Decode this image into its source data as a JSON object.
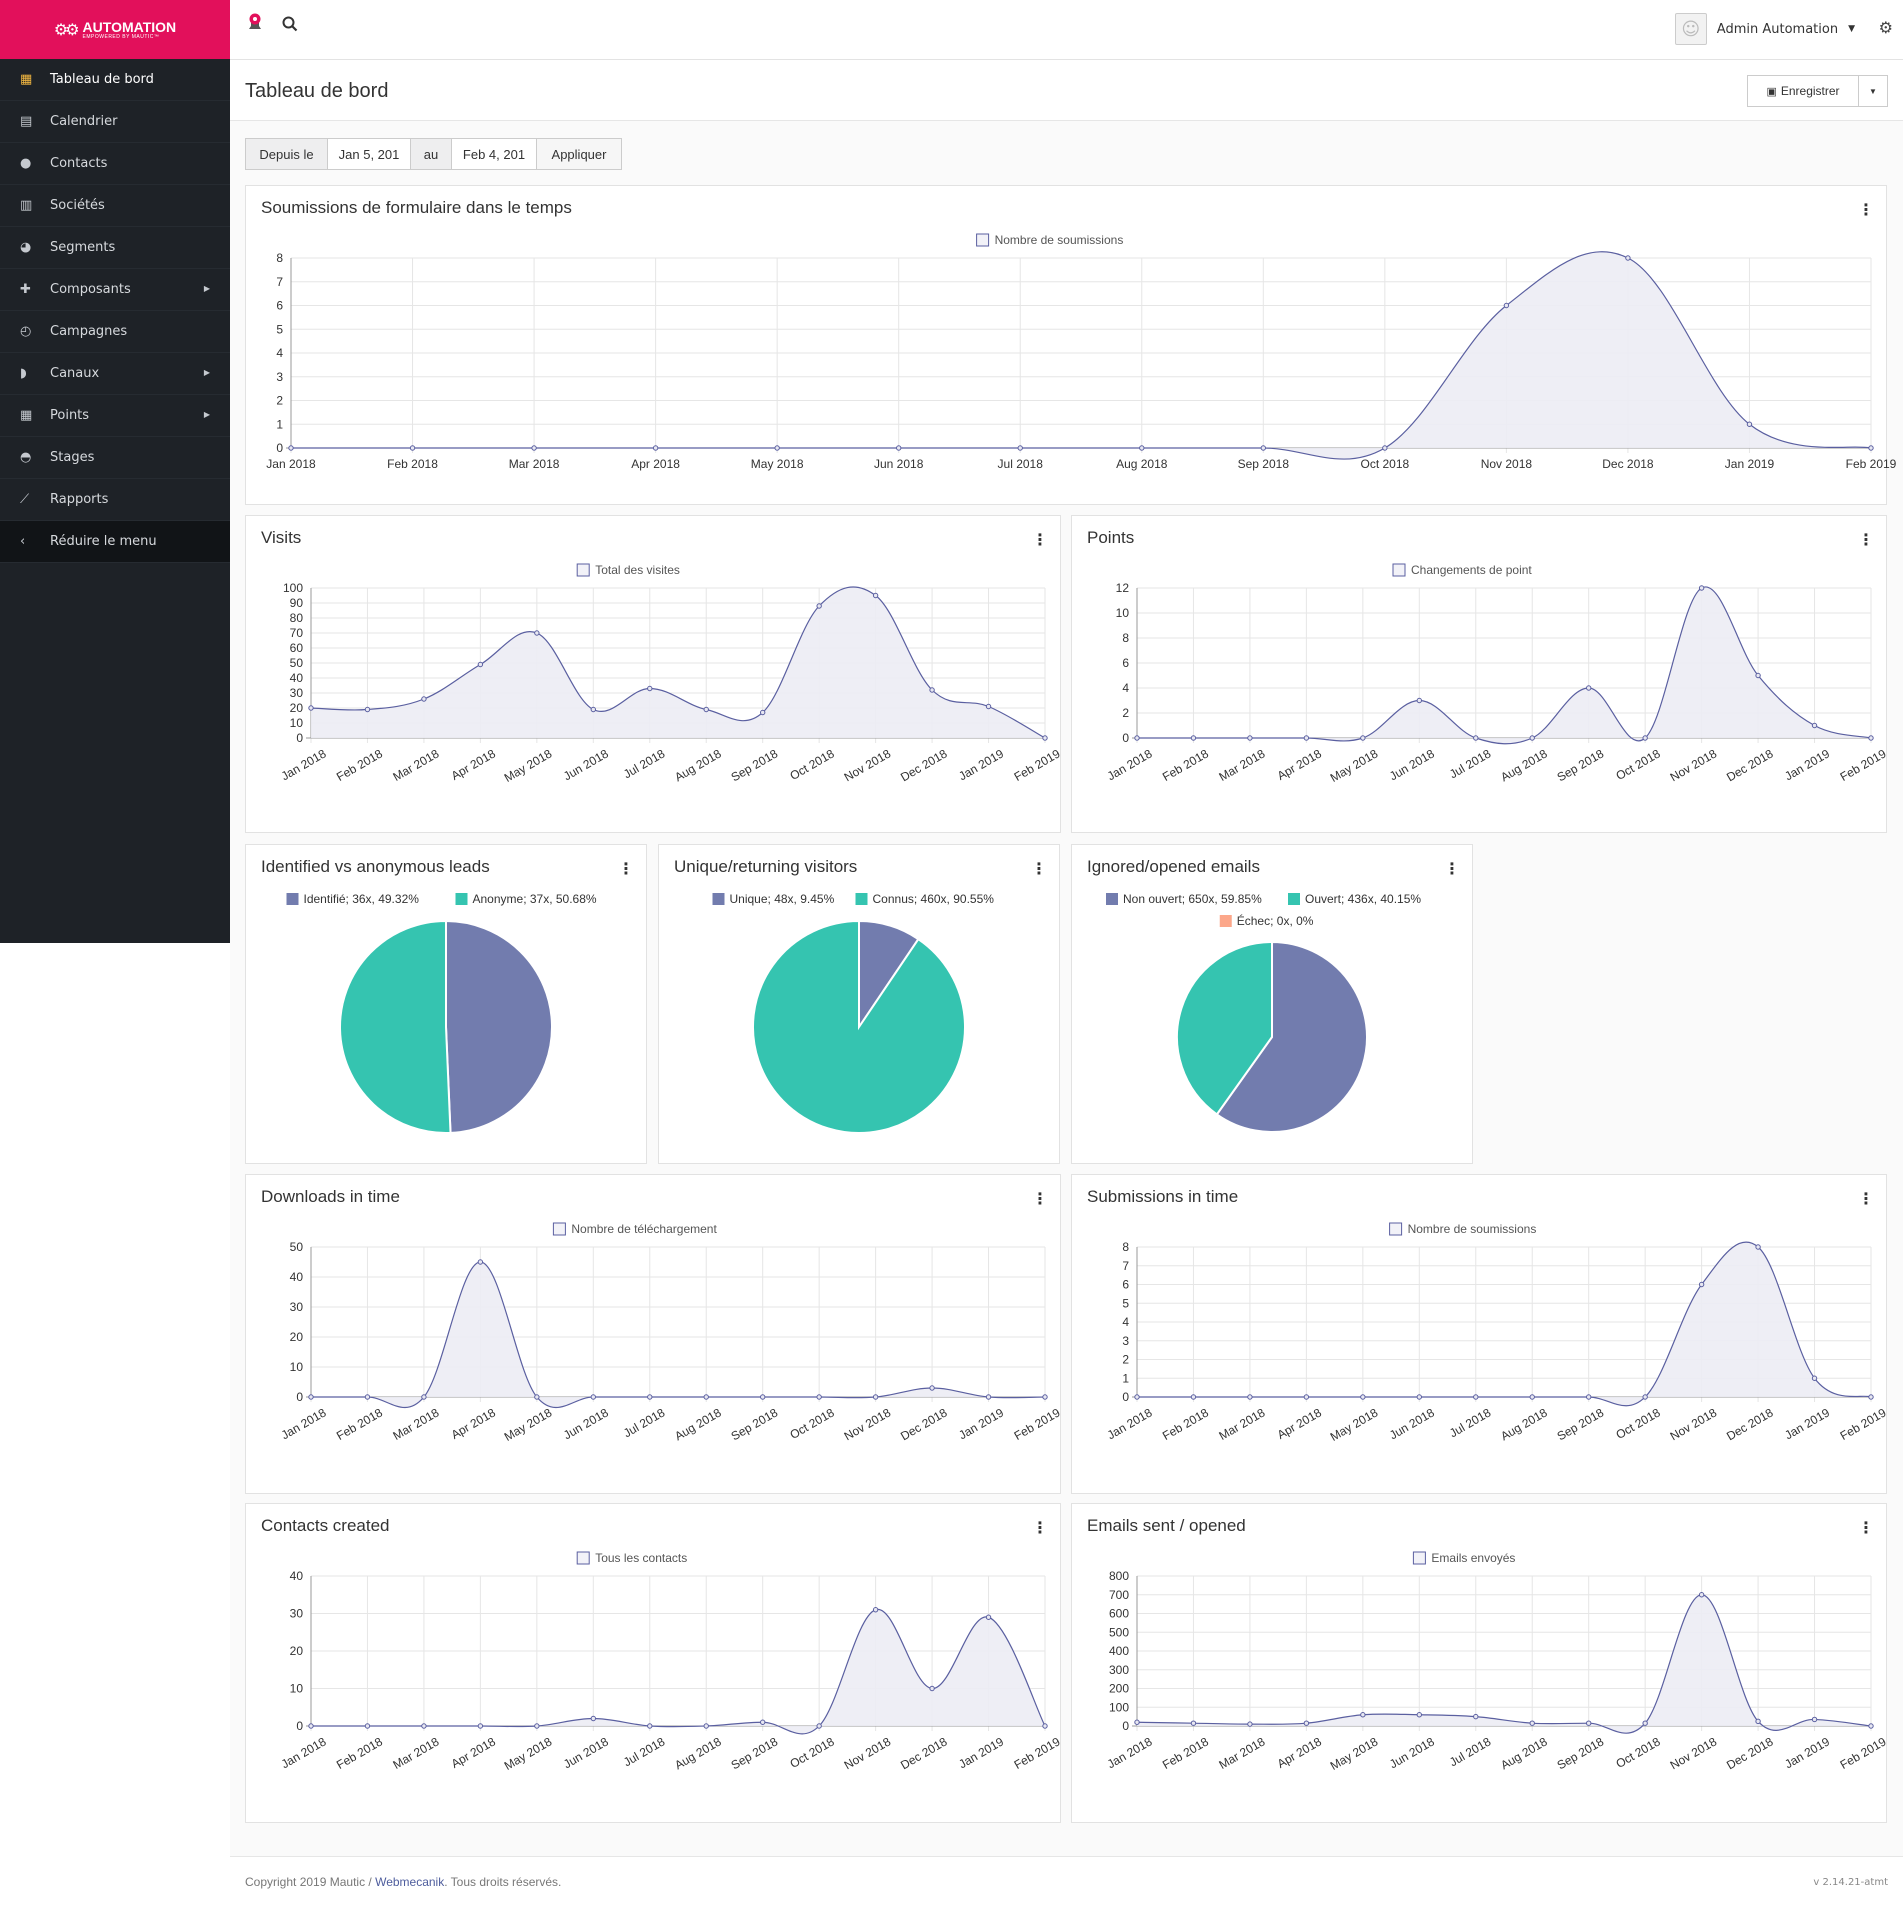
{
  "brand": {
    "name": "AUTOMATION",
    "tagline": "EMPOWERED BY MAUTIC™"
  },
  "sidebar": {
    "items": [
      {
        "label": "Tableau de bord",
        "icon": "grid-icon",
        "glyph": "▦",
        "active": true,
        "submenu": false
      },
      {
        "label": "Calendrier",
        "icon": "calendar-icon",
        "glyph": "▤",
        "active": false,
        "submenu": false
      },
      {
        "label": "Contacts",
        "icon": "user-icon",
        "glyph": "●",
        "active": false,
        "submenu": false
      },
      {
        "label": "Sociétés",
        "icon": "building-icon",
        "glyph": "▥",
        "active": false,
        "submenu": false
      },
      {
        "label": "Segments",
        "icon": "pie-chart-icon",
        "glyph": "◕",
        "active": false,
        "submenu": false
      },
      {
        "label": "Composants",
        "icon": "puzzle-icon",
        "glyph": "✚",
        "active": false,
        "submenu": true
      },
      {
        "label": "Campagnes",
        "icon": "clock-icon",
        "glyph": "◴",
        "active": false,
        "submenu": false
      },
      {
        "label": "Canaux",
        "icon": "rss-icon",
        "glyph": "◗",
        "active": false,
        "submenu": true
      },
      {
        "label": "Points",
        "icon": "calculator-icon",
        "glyph": "▦",
        "active": false,
        "submenu": true
      },
      {
        "label": "Stages",
        "icon": "tachometer-icon",
        "glyph": "◓",
        "active": false,
        "submenu": false
      },
      {
        "label": "Rapports",
        "icon": "line-chart-icon",
        "glyph": "⟋",
        "active": false,
        "submenu": false
      }
    ],
    "collapse_label": "Réduire le menu"
  },
  "topbar": {
    "user_name": "Admin Automation"
  },
  "page": {
    "title": "Tableau de bord",
    "save_label": "Enregistrer"
  },
  "filter": {
    "from_label": "Depuis le",
    "from_value": "Jan 5, 201",
    "to_label": "au",
    "to_value": "Feb 4, 201",
    "apply_label": "Appliquer"
  },
  "colors": {
    "line": "#5a5fa0",
    "fill": "#ececf4",
    "pie_purple": "#727cae",
    "pie_teal": "#35c4b0",
    "pie_salmon": "#fca78a",
    "brand": "#e2105b"
  },
  "chart_data": [
    {
      "id": "w1",
      "type": "area",
      "title": "Soumissions de formulaire dans le temps",
      "series": [
        {
          "name": "Nombre de soumissions",
          "values": [
            0,
            0,
            0,
            0,
            0,
            0,
            0,
            0,
            0,
            0,
            6,
            8,
            1,
            0
          ]
        }
      ],
      "x": [
        "Jan 2018",
        "Feb 2018",
        "Mar 2018",
        "Apr 2018",
        "May 2018",
        "Jun 2018",
        "Jul 2018",
        "Aug 2018",
        "Sep 2018",
        "Oct 2018",
        "Nov 2018",
        "Dec 2018",
        "Jan 2019",
        "Feb 2019"
      ],
      "yticks": [
        0,
        1,
        2,
        3,
        4,
        5,
        6,
        7,
        8
      ],
      "ylim": [
        0,
        8
      ]
    },
    {
      "id": "w2",
      "type": "area",
      "title": "Visits",
      "series": [
        {
          "name": "Total des visites",
          "values": [
            20,
            19,
            26,
            49,
            70,
            19,
            33,
            19,
            17,
            88,
            95,
            32,
            21,
            0
          ]
        }
      ],
      "x": [
        "Jan 2018",
        "Feb 2018",
        "Mar 2018",
        "Apr 2018",
        "May 2018",
        "Jun 2018",
        "Jul 2018",
        "Aug 2018",
        "Sep 2018",
        "Oct 2018",
        "Nov 2018",
        "Dec 2018",
        "Jan 2019",
        "Feb 2019"
      ],
      "yticks": [
        0,
        10,
        20,
        30,
        40,
        50,
        60,
        70,
        80,
        90,
        100
      ],
      "ylim": [
        0,
        100
      ]
    },
    {
      "id": "w3",
      "type": "area",
      "title": "Points",
      "series": [
        {
          "name": "Changements de point",
          "values": [
            0,
            0,
            0,
            0,
            0,
            3,
            0,
            0,
            4,
            0,
            12,
            5,
            1,
            0
          ]
        }
      ],
      "x": [
        "Jan 2018",
        "Feb 2018",
        "Mar 2018",
        "Apr 2018",
        "May 2018",
        "Jun 2018",
        "Jul 2018",
        "Aug 2018",
        "Sep 2018",
        "Oct 2018",
        "Nov 2018",
        "Dec 2018",
        "Jan 2019",
        "Feb 2019"
      ],
      "yticks": [
        0,
        2,
        4,
        6,
        8,
        10,
        12
      ],
      "ylim": [
        0,
        12
      ]
    },
    {
      "id": "w4",
      "type": "pie",
      "title": "Identified vs anonymous leads",
      "slices": [
        {
          "label": "Identifié; 36x, 49.32%",
          "value": 49.32,
          "color": "#727cae"
        },
        {
          "label": "Anonyme; 37x, 50.68%",
          "value": 50.68,
          "color": "#35c4b0"
        }
      ]
    },
    {
      "id": "w5",
      "type": "pie",
      "title": "Unique/returning visitors",
      "slices": [
        {
          "label": "Unique; 48x, 9.45%",
          "value": 9.45,
          "color": "#727cae"
        },
        {
          "label": "Connus; 460x, 90.55%",
          "value": 90.55,
          "color": "#35c4b0"
        }
      ]
    },
    {
      "id": "w6",
      "type": "pie",
      "title": "Ignored/opened emails",
      "slices": [
        {
          "label": "Non ouvert; 650x, 59.85%",
          "value": 59.85,
          "color": "#727cae"
        },
        {
          "label": "Ouvert; 436x, 40.15%",
          "value": 40.15,
          "color": "#35c4b0"
        },
        {
          "label": "Échec; 0x, 0%",
          "value": 0,
          "color": "#fca78a"
        }
      ]
    },
    {
      "id": "w7",
      "type": "area",
      "title": "Downloads in time",
      "series": [
        {
          "name": "Nombre de téléchargement",
          "values": [
            0,
            0,
            0,
            45,
            0,
            0,
            0,
            0,
            0,
            0,
            0,
            3,
            0,
            0
          ]
        }
      ],
      "x": [
        "Jan 2018",
        "Feb 2018",
        "Mar 2018",
        "Apr 2018",
        "May 2018",
        "Jun 2018",
        "Jul 2018",
        "Aug 2018",
        "Sep 2018",
        "Oct 2018",
        "Nov 2018",
        "Dec 2018",
        "Jan 2019",
        "Feb 2019"
      ],
      "yticks": [
        0,
        10,
        20,
        30,
        40,
        50
      ],
      "ylim": [
        0,
        50
      ]
    },
    {
      "id": "w8",
      "type": "area",
      "title": "Submissions in time",
      "series": [
        {
          "name": "Nombre de soumissions",
          "values": [
            0,
            0,
            0,
            0,
            0,
            0,
            0,
            0,
            0,
            0,
            6,
            8,
            1,
            0
          ]
        }
      ],
      "x": [
        "Jan 2018",
        "Feb 2018",
        "Mar 2018",
        "Apr 2018",
        "May 2018",
        "Jun 2018",
        "Jul 2018",
        "Aug 2018",
        "Sep 2018",
        "Oct 2018",
        "Nov 2018",
        "Dec 2018",
        "Jan 2019",
        "Feb 2019"
      ],
      "yticks": [
        0,
        1,
        2,
        3,
        4,
        5,
        6,
        7,
        8
      ],
      "ylim": [
        0,
        8
      ]
    },
    {
      "id": "w9",
      "type": "area",
      "title": "Contacts created",
      "series": [
        {
          "name": "Tous les contacts",
          "values": [
            0,
            0,
            0,
            0,
            0,
            2,
            0,
            0,
            1,
            0,
            31,
            10,
            29,
            0
          ]
        }
      ],
      "x": [
        "Jan 2018",
        "Feb 2018",
        "Mar 2018",
        "Apr 2018",
        "May 2018",
        "Jun 2018",
        "Jul 2018",
        "Aug 2018",
        "Sep 2018",
        "Oct 2018",
        "Nov 2018",
        "Dec 2018",
        "Jan 2019",
        "Feb 2019"
      ],
      "yticks": [
        0,
        10,
        20,
        30,
        40
      ],
      "ylim": [
        0,
        40
      ]
    },
    {
      "id": "w10",
      "type": "area",
      "title": "Emails sent / opened",
      "series": [
        {
          "name": "Emails envoyés",
          "values": [
            20,
            15,
            10,
            15,
            60,
            60,
            50,
            15,
            15,
            15,
            700,
            25,
            35,
            0
          ]
        }
      ],
      "x": [
        "Jan 2018",
        "Feb 2018",
        "Mar 2018",
        "Apr 2018",
        "May 2018",
        "Jun 2018",
        "Jul 2018",
        "Aug 2018",
        "Sep 2018",
        "Oct 2018",
        "Nov 2018",
        "Dec 2018",
        "Jan 2019",
        "Feb 2019"
      ],
      "yticks": [
        0,
        100,
        200,
        300,
        400,
        500,
        600,
        700,
        800
      ],
      "ylim": [
        0,
        800
      ]
    }
  ],
  "footer": {
    "copyright": "Copyright 2019 Mautic /",
    "company": "Webmecanik",
    "rights": ". Tous droits réservés.",
    "version": "v 2.14.21-atmt"
  }
}
